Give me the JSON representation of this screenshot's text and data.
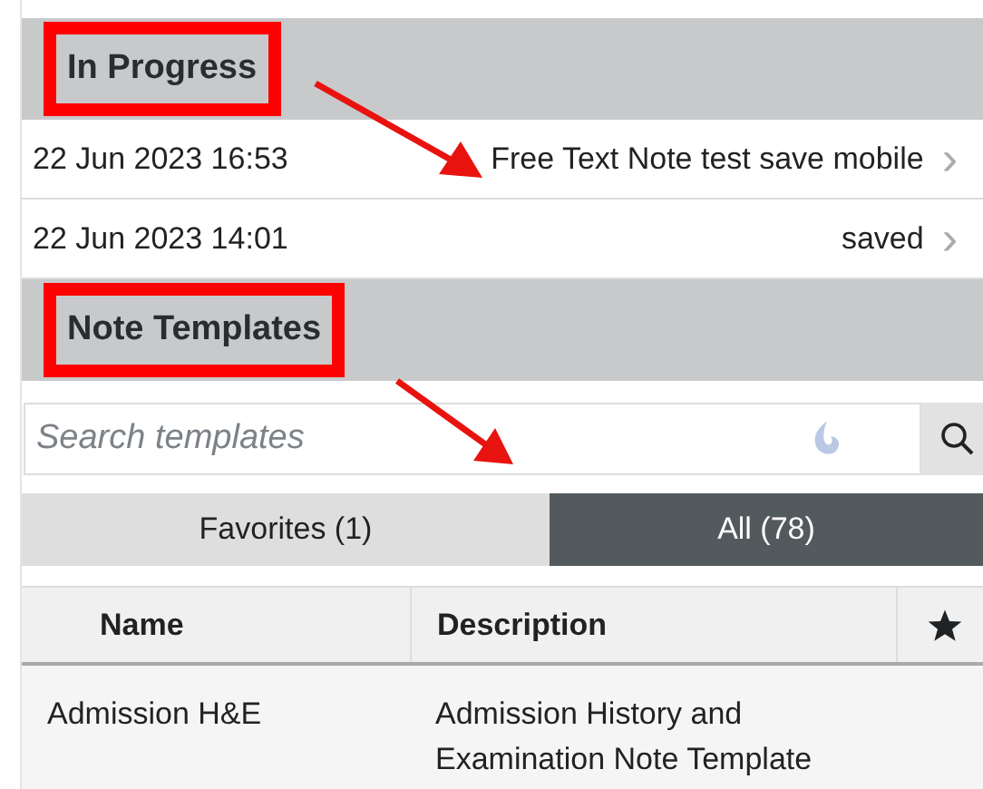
{
  "in_progress": {
    "title": "In Progress",
    "highlighted": true,
    "arrow": true,
    "rows": [
      {
        "date": "22 Jun 2023 16:53",
        "title": "Free Text Note test save mobile",
        "chevron": "›"
      },
      {
        "date": "22 Jun 2023 14:01",
        "title": "saved",
        "chevron": "›"
      }
    ]
  },
  "note_templates": {
    "title": "Note Templates",
    "highlighted": true,
    "arrow": true,
    "search": {
      "placeholder": "Search templates"
    },
    "tabs": [
      {
        "label": "Favorites (1)",
        "selected": false
      },
      {
        "label": "All (78)",
        "selected": true
      }
    ],
    "table": {
      "columns": [
        "Name",
        "Description"
      ],
      "rows": [
        {
          "name": "Admission H&E",
          "description": "Admission History and Examination Note Template"
        }
      ]
    }
  }
}
